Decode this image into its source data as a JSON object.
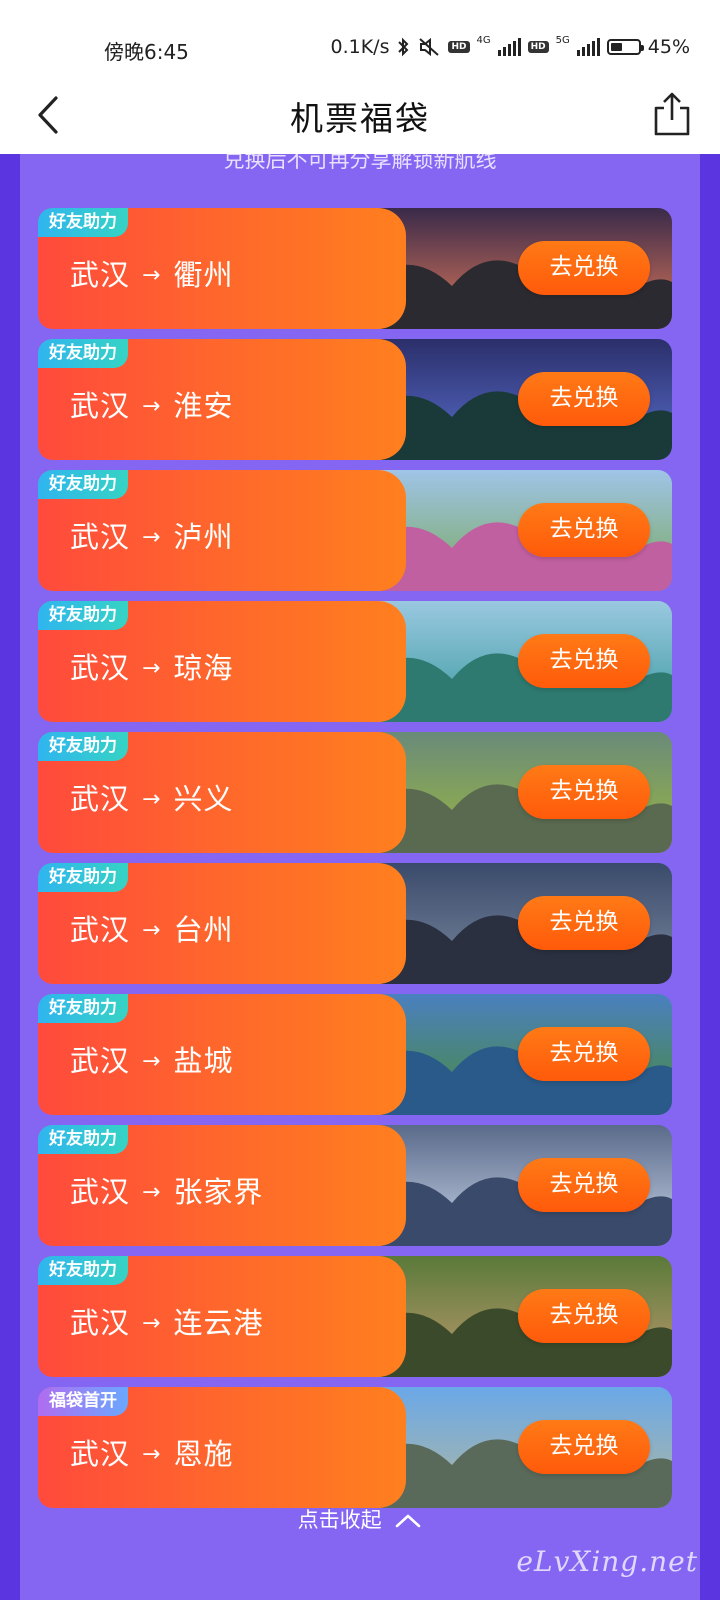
{
  "status_bar": {
    "time": "傍晚6:45",
    "net_speed": "0.1K/s",
    "hd1": "HD",
    "gen1": "4G",
    "hd2": "HD",
    "gen2": "5G",
    "battery_text": "45%",
    "battery_level": 0.45,
    "icons": [
      "bluetooth-icon",
      "mute-icon",
      "signal-icon",
      "battery-icon"
    ]
  },
  "header": {
    "title": "机票福袋",
    "back_icon": "chevron-left-icon",
    "share_icon": "share-icon"
  },
  "notice": "兑换后不可再分享解锁新航线",
  "redeem_label": "去兑换",
  "cards": [
    {
      "tag": "好友助力",
      "origin": "武汉",
      "arrow": "→",
      "destination": "衢州"
    },
    {
      "tag": "好友助力",
      "origin": "武汉",
      "arrow": "→",
      "destination": "淮安"
    },
    {
      "tag": "好友助力",
      "origin": "武汉",
      "arrow": "→",
      "destination": "泸州"
    },
    {
      "tag": "好友助力",
      "origin": "武汉",
      "arrow": "→",
      "destination": "琼海"
    },
    {
      "tag": "好友助力",
      "origin": "武汉",
      "arrow": "→",
      "destination": "兴义"
    },
    {
      "tag": "好友助力",
      "origin": "武汉",
      "arrow": "→",
      "destination": "台州"
    },
    {
      "tag": "好友助力",
      "origin": "武汉",
      "arrow": "→",
      "destination": "盐城"
    },
    {
      "tag": "好友助力",
      "origin": "武汉",
      "arrow": "→",
      "destination": "张家界"
    },
    {
      "tag": "好友助力",
      "origin": "武汉",
      "arrow": "→",
      "destination": "连云港"
    },
    {
      "tag": "福袋首开",
      "origin": "武汉",
      "arrow": "→",
      "destination": "恩施"
    }
  ],
  "collapse_label": "点击收起",
  "watermark": "eLvXing.net",
  "colors": {
    "page_bg": "#5a35e0",
    "panel_bg": "#8566f3",
    "card_orange": "#ff6a2a",
    "tag_teal": "#2fb5ef",
    "button_orange": "#ff7a16"
  }
}
